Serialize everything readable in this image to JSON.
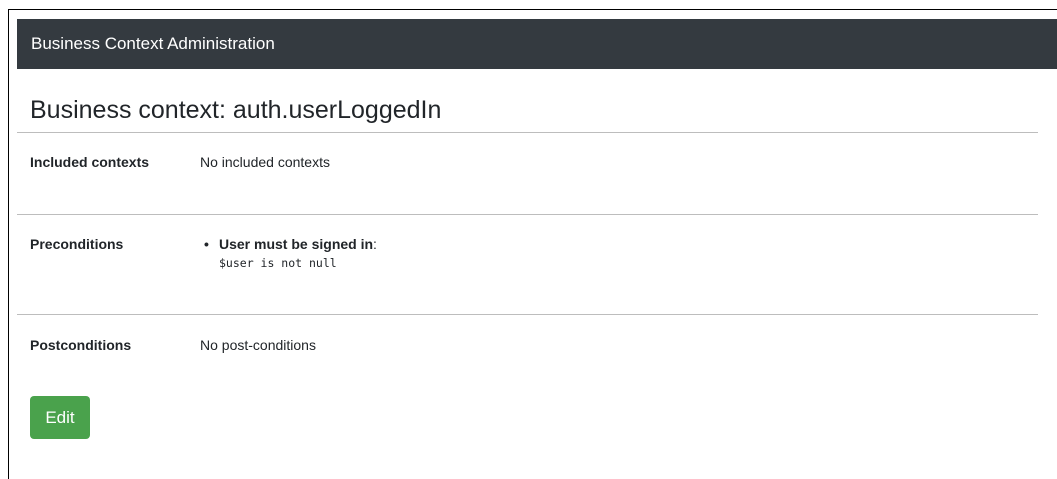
{
  "navbar": {
    "brand": "Business Context Administration"
  },
  "page": {
    "title": "Business context: auth.userLoggedIn"
  },
  "sections": {
    "included": {
      "label": "Included contexts",
      "value": "No included contexts"
    },
    "preconditions": {
      "label": "Preconditions",
      "items": [
        {
          "name": "User must be signed in",
          "separator": ":",
          "expression": "$user is not null"
        }
      ]
    },
    "postconditions": {
      "label": "Postconditions",
      "value": "No post-conditions"
    }
  },
  "actions": {
    "edit_label": "Edit"
  },
  "colors": {
    "navbar_bg": "#343a40",
    "edit_button_bg": "#4aa24c",
    "divider": "#bdbdbd"
  }
}
